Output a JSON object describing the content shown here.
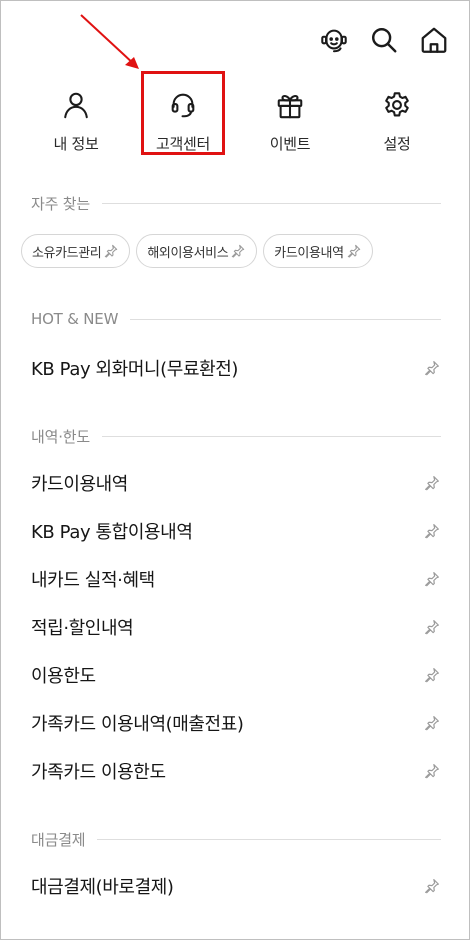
{
  "topbar": {
    "icons": [
      "chatbot-icon",
      "search-icon",
      "home-icon"
    ]
  },
  "quick_menu": [
    {
      "label": "내 정보",
      "icon": "person-icon"
    },
    {
      "label": "고객센터",
      "icon": "headset-icon"
    },
    {
      "label": "이벤트",
      "icon": "gift-icon"
    },
    {
      "label": "설정",
      "icon": "gear-icon"
    }
  ],
  "annotation": {
    "highlight_color": "#e01212"
  },
  "frequent": {
    "title": "자주 찾는",
    "chips": [
      "소유카드관리",
      "해외이용서비스",
      "카드이용내역"
    ]
  },
  "hot_new": {
    "title": "HOT & NEW",
    "items": [
      "KB Pay 외화머니(무료환전)"
    ]
  },
  "history_limit": {
    "title": "내역·한도",
    "items": [
      "카드이용내역",
      "KB Pay 통합이용내역",
      "내카드 실적·혜택",
      "적립·할인내역",
      "이용한도",
      "가족카드 이용내역(매출전표)",
      "가족카드 이용한도"
    ]
  },
  "payment": {
    "title": "대금결제",
    "items": [
      "대금결제(바로결제)"
    ]
  }
}
